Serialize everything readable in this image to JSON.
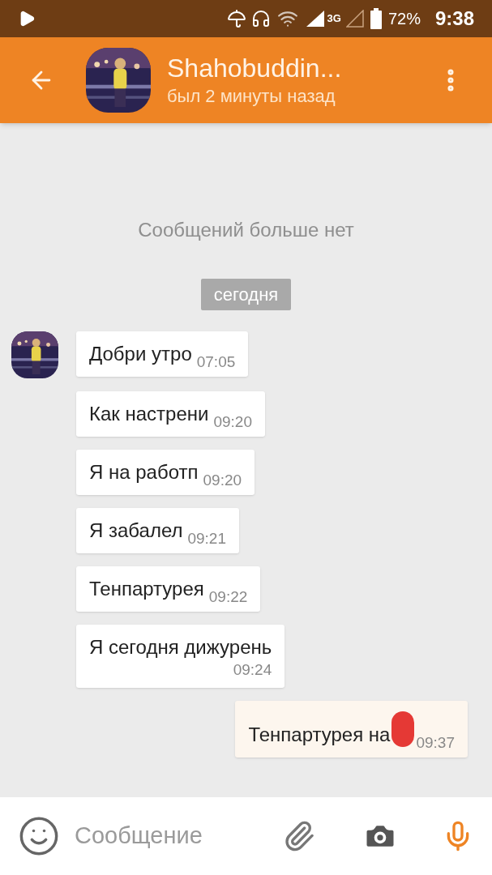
{
  "status_bar": {
    "battery": "72%",
    "time": "9:38",
    "network": "3G"
  },
  "header": {
    "name": "Shahobuddin...",
    "status": "был 2 минуты назад"
  },
  "notice": "Сообщений больше нет",
  "date_label": "сегодня",
  "messages": [
    {
      "kind": "incoming",
      "text": "Добри утро",
      "time": "07:05",
      "avatar": true
    },
    {
      "kind": "incoming",
      "text": "Как настрени",
      "time": "09:20",
      "avatar": false
    },
    {
      "kind": "incoming",
      "text": "Я на работп",
      "time": "09:20",
      "avatar": false
    },
    {
      "kind": "incoming",
      "text": "Я забалел",
      "time": "09:21",
      "avatar": false
    },
    {
      "kind": "incoming",
      "text": "Тенпартурея",
      "time": "09:22",
      "avatar": false
    },
    {
      "kind": "incoming",
      "text": "Я сегодня дижурень",
      "time": "09:24",
      "avatar": false,
      "wrap": true
    },
    {
      "kind": "outgoing",
      "text": "Тенпартурея на",
      "time": "09:37",
      "redacted": true
    }
  ],
  "composer": {
    "placeholder": "Сообщение"
  }
}
